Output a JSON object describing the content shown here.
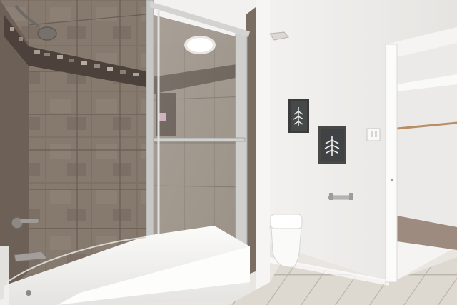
{
  "scene": {
    "colors": {
      "tile_dark": "#6f6358",
      "tile_mid": "#857a6f",
      "tile_light": "#9a8f84",
      "grout": "#5a5048",
      "wall": "#eeecea",
      "ceiling": "#f3f1ef",
      "floor_tile": "#ddd8d0",
      "floor_grout": "#b9b2a8",
      "frame_metal": "#c9c9c7",
      "glass_tint": "#b9b3ad",
      "tub": "#f7f7f5",
      "closet_wall": "#ececea",
      "closet_rug": "#9c8b7e"
    },
    "icons": {
      "light": "ceiling-light-icon",
      "shower": "shower-head-icon",
      "towel": "towel-ring-icon"
    }
  }
}
